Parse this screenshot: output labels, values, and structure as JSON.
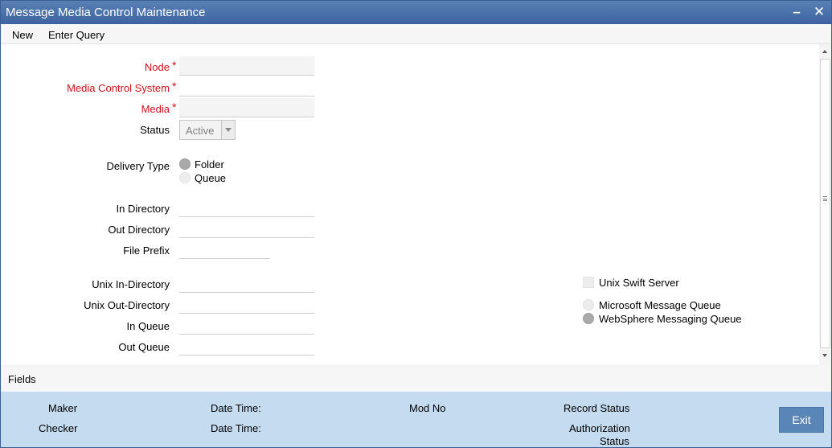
{
  "window": {
    "title": "Message Media Control Maintenance",
    "minimize_icon": "minimize-icon",
    "close_icon": "close-icon",
    "minimize_glyph": "–",
    "close_glyph": "✕"
  },
  "menu": {
    "new": "New",
    "enter_query": "Enter Query"
  },
  "form": {
    "node_label": "Node",
    "media_control_system_label": "Media Control System",
    "media_label": "Media",
    "required_mark": "*",
    "status_label": "Status",
    "status_value": "Active",
    "delivery_type_label": "Delivery Type",
    "delivery_options": [
      "Folder",
      "Queue"
    ],
    "delivery_selected": "Folder",
    "in_directory_label": "In Directory",
    "out_directory_label": "Out Directory",
    "file_prefix_label": "File Prefix",
    "unix_in_directory_label": "Unix In-Directory",
    "unix_out_directory_label": "Unix Out-Directory",
    "in_queue_label": "In Queue",
    "out_queue_label": "Out Queue",
    "unix_swift_server_label": "Unix Swift Server",
    "queue_options": [
      "Microsoft Message Queue",
      "WebSphere Messaging Queue"
    ],
    "queue_selected": "WebSphere Messaging Queue",
    "values": {
      "node": "",
      "media_control_system": "",
      "media": "",
      "in_directory": "",
      "out_directory": "",
      "file_prefix": "",
      "unix_in_directory": "",
      "unix_out_directory": "",
      "in_queue": "",
      "out_queue": ""
    }
  },
  "fields_bar": {
    "label": "Fields"
  },
  "footer": {
    "maker": "Maker",
    "checker": "Checker",
    "date_time_1": "Date Time:",
    "date_time_2": "Date Time:",
    "mod_no": "Mod No",
    "record_status": "Record Status",
    "authorization": "Authorization",
    "status": "Status",
    "exit": "Exit"
  },
  "colors": {
    "titlebar": "#3d64a0",
    "required": "#d0111b",
    "footer": "#c5dcf0",
    "exit_button": "#5a86b7"
  }
}
